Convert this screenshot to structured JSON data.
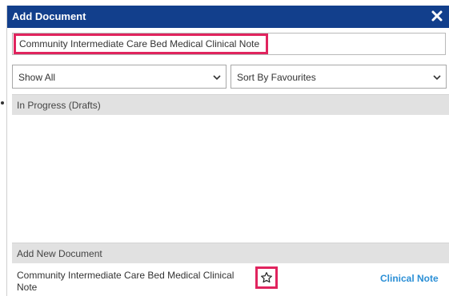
{
  "dialog": {
    "title": "Add Document",
    "close_icon": "close-icon"
  },
  "search": {
    "value": "Community Intermediate Care Bed Medical Clinical Note"
  },
  "filters": {
    "show_label": "Show All",
    "sort_label": "Sort By Favourites"
  },
  "sections": {
    "drafts_title": "In Progress (Drafts)",
    "new_title": "Add New Document"
  },
  "documents": [
    {
      "name": "Community Intermediate Care Bed Medical Clinical Note",
      "type": "Clinical Note",
      "favourite_icon": "star-outline-icon"
    }
  ],
  "colors": {
    "titlebar": "#123f8c",
    "highlight": "#e0245e",
    "link": "#2b8fd6"
  }
}
